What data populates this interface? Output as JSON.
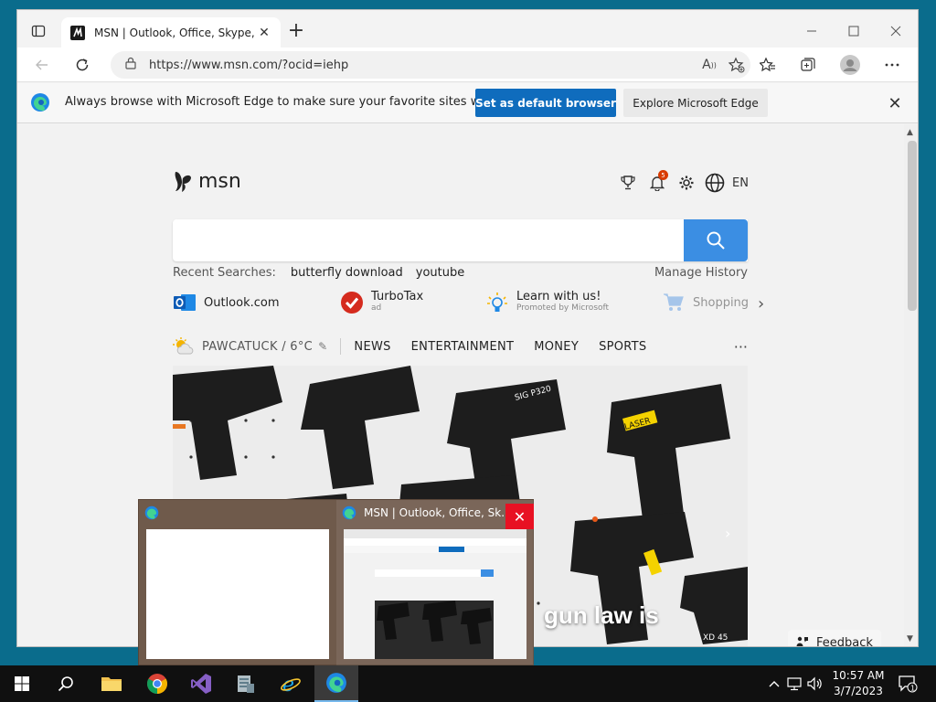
{
  "browser": {
    "tab_title": "MSN | Outlook, Office, Skype, Bing",
    "url": "https://www.msn.com/?ocid=iehp"
  },
  "banner": {
    "message": "Always browse with Microsoft Edge to make sure your favorite sites work",
    "primary_button": "Set as default browser",
    "secondary_button": "Explore Microsoft Edge"
  },
  "msn": {
    "logo_text": "msn",
    "notification_count": "5",
    "language": "EN",
    "recent_label": "Recent Searches:",
    "recent_terms": [
      "butterfly download",
      "youtube"
    ],
    "manage_history": "Manage History",
    "quicklinks": [
      {
        "label": "Outlook.com",
        "sub": ""
      },
      {
        "label": "TurboTax",
        "sub": "ad"
      },
      {
        "label": "Learn with us!",
        "sub": "Promoted by Microsoft"
      },
      {
        "label": "Shopping",
        "sub": ""
      }
    ],
    "weather": "PAWCATUCK / 6°C",
    "nav": [
      "NEWS",
      "ENTERTAINMENT",
      "MONEY",
      "SPORTS"
    ],
    "more": "···",
    "hero_headline": "gun law is",
    "feedback": "Feedback"
  },
  "preview": {
    "window_title": "MSN | Outlook, Office, Sk..."
  },
  "taskbar": {
    "time": "10:57 AM",
    "date": "3/7/2023",
    "notification_count": "1"
  },
  "colors": {
    "accent": "#0f6cbd",
    "search_button": "#3b8ee3",
    "close_red": "#e81123",
    "taskbar": "#101010"
  }
}
